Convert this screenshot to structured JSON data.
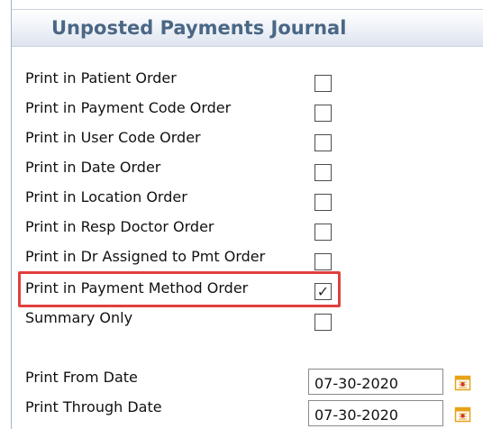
{
  "title": "Unposted Payments Journal",
  "options": [
    {
      "label": "Print in Patient Order",
      "checked": false,
      "mark": ""
    },
    {
      "label": "Print in Payment Code Order",
      "checked": false,
      "mark": ""
    },
    {
      "label": "Print in User Code Order",
      "checked": false,
      "mark": ""
    },
    {
      "label": "Print in Date Order",
      "checked": false,
      "mark": ""
    },
    {
      "label": "Print in Location Order",
      "checked": false,
      "mark": ""
    },
    {
      "label": "Print in Resp Doctor Order",
      "checked": false,
      "mark": ""
    },
    {
      "label": "Print in Dr Assigned to Pmt Order",
      "checked": false,
      "mark": ""
    },
    {
      "label": "Print in Payment Method Order",
      "checked": true,
      "mark": "✓"
    },
    {
      "label": "Summary Only",
      "checked": false,
      "mark": ""
    }
  ],
  "dates": {
    "from_label": "Print From Date",
    "from_value": "07-30-2020",
    "through_label": "Print Through Date",
    "through_value": "07-30-2020"
  },
  "colors": {
    "title": "#4a6785",
    "highlight": "#e0403d",
    "calendar_icon": "#e8a21a"
  }
}
